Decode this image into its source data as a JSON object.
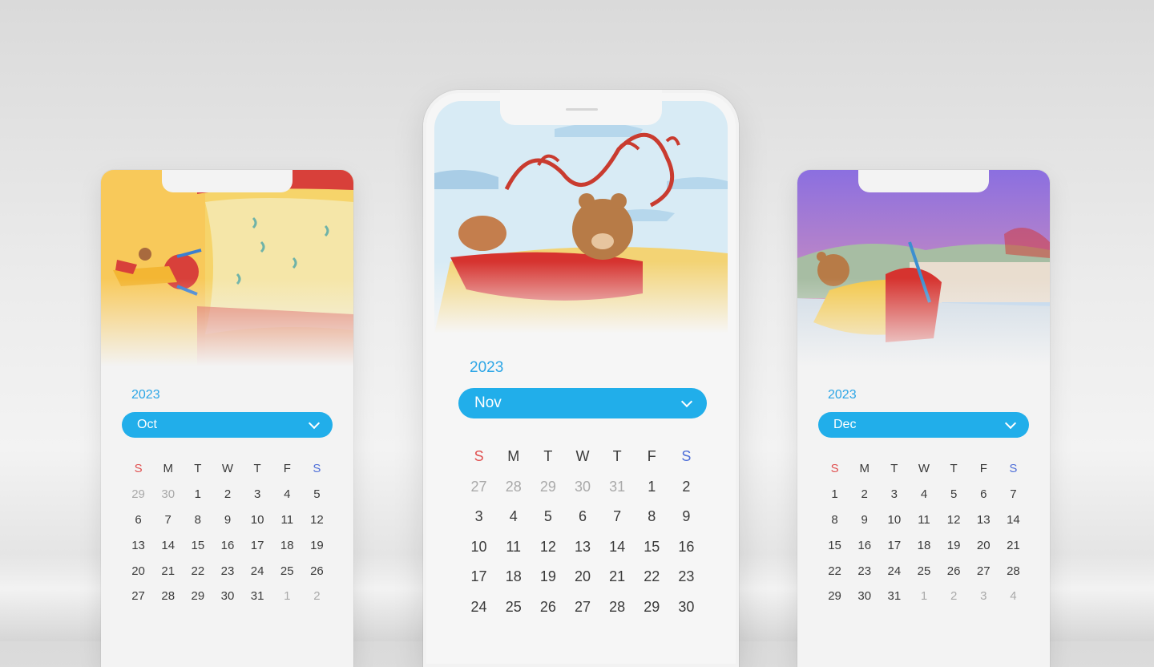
{
  "weekday_headers": [
    "S",
    "M",
    "T",
    "W",
    "T",
    "F",
    "S"
  ],
  "colors": {
    "accent": "#21aeea",
    "sunday": "#e05151",
    "saturday": "#4f6fd8",
    "muted": "#a9a9a9"
  },
  "calendars": {
    "left": {
      "year": "2023",
      "month": "Oct",
      "days": [
        [
          "29",
          "30",
          "1",
          "2",
          "3",
          "4",
          "5"
        ],
        [
          "6",
          "7",
          "8",
          "9",
          "10",
          "11",
          "12"
        ],
        [
          "13",
          "14",
          "15",
          "16",
          "17",
          "18",
          "19"
        ],
        [
          "20",
          "21",
          "22",
          "23",
          "24",
          "25",
          "26"
        ],
        [
          "27",
          "28",
          "29",
          "30",
          "31",
          "1",
          "2"
        ]
      ],
      "muted": [
        [
          0,
          0
        ],
        [
          0,
          1
        ],
        [
          4,
          5
        ],
        [
          4,
          6
        ]
      ]
    },
    "center": {
      "year": "2023",
      "month": "Nov",
      "days": [
        [
          "27",
          "28",
          "29",
          "30",
          "31",
          "1",
          "2"
        ],
        [
          "3",
          "4",
          "5",
          "6",
          "7",
          "8",
          "9"
        ],
        [
          "10",
          "11",
          "12",
          "13",
          "14",
          "15",
          "16"
        ],
        [
          "17",
          "18",
          "19",
          "20",
          "21",
          "22",
          "23"
        ],
        [
          "24",
          "25",
          "26",
          "27",
          "28",
          "29",
          "30"
        ]
      ],
      "muted": [
        [
          0,
          0
        ],
        [
          0,
          1
        ],
        [
          0,
          2
        ],
        [
          0,
          3
        ],
        [
          0,
          4
        ]
      ]
    },
    "right": {
      "year": "2023",
      "month": "Dec",
      "days": [
        [
          "1",
          "2",
          "3",
          "4",
          "5",
          "6",
          "7"
        ],
        [
          "8",
          "9",
          "10",
          "11",
          "12",
          "13",
          "14"
        ],
        [
          "15",
          "16",
          "17",
          "18",
          "19",
          "20",
          "21"
        ],
        [
          "22",
          "23",
          "24",
          "25",
          "26",
          "27",
          "28"
        ],
        [
          "29",
          "30",
          "31",
          "1",
          "2",
          "3",
          "4"
        ]
      ],
      "muted": [
        [
          4,
          3
        ],
        [
          4,
          4
        ],
        [
          4,
          5
        ],
        [
          4,
          6
        ]
      ]
    }
  }
}
